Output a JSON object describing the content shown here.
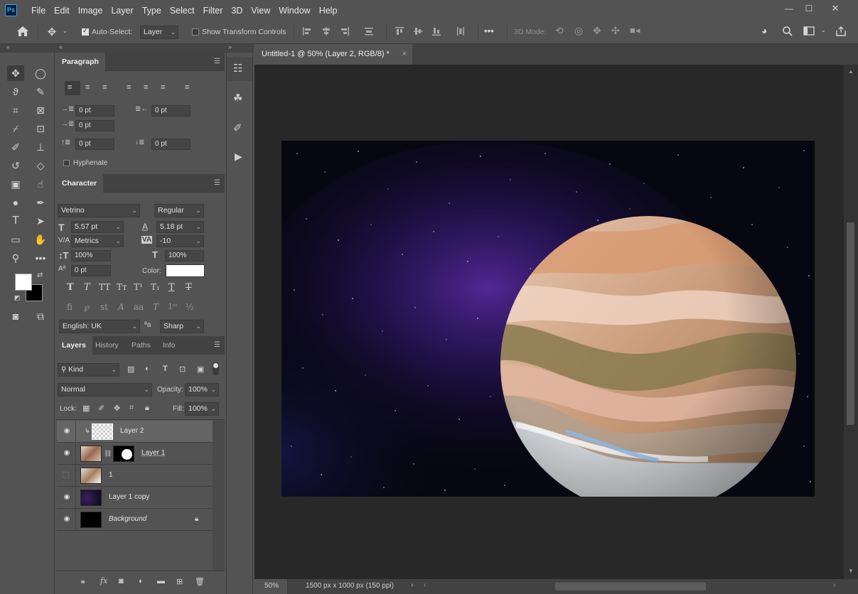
{
  "app": {
    "logo": "Ps",
    "menus": [
      "File",
      "Edit",
      "Image",
      "Layer",
      "Type",
      "Select",
      "Filter",
      "3D",
      "View",
      "Window",
      "Help"
    ],
    "window_controls": [
      "—",
      "☐",
      "✕"
    ]
  },
  "options": {
    "auto_select_label": "Auto-Select:",
    "auto_select_target": "Layer",
    "transform_label": "Show Transform Controls",
    "mode_label": "3D Mode:",
    "more": "•••"
  },
  "paragraph": {
    "tab": "Paragraph",
    "indent_left": "0 pt",
    "indent_right": "0 pt",
    "indent_first": "0 pt",
    "space_before": "0 pt",
    "space_after": "0 pt",
    "hyphenate": "Hyphenate"
  },
  "character": {
    "tab": "Character",
    "font_family": "Vetrino",
    "font_style": "Regular",
    "size": "5.57 pt",
    "leading": "5.18 pt",
    "kerning": "Metrics",
    "tracking": "-10",
    "vscale": "100%",
    "hscale": "100%",
    "baseline": "0 pt",
    "color_label": "Color:",
    "color": "#ffffff",
    "language": "English: UK",
    "aa_label": "ªa",
    "antialias": "Sharp"
  },
  "layers_panel": {
    "tabs": [
      "Layers",
      "History",
      "Paths",
      "Info"
    ],
    "filter": "Kind",
    "blend": "Normal",
    "opacity_label": "Opacity:",
    "opacity": "100%",
    "lock_label": "Lock:",
    "fill_label": "Fill:",
    "fill": "100%",
    "layers": [
      {
        "name": "Layer 2",
        "visible": true,
        "selected": true
      },
      {
        "name": "Layer 1",
        "visible": true,
        "selected": false
      },
      {
        "name": "1",
        "visible": false,
        "selected": false
      },
      {
        "name": "Layer 1 copy",
        "visible": true,
        "selected": false
      },
      {
        "name": "Background",
        "visible": true,
        "selected": false
      }
    ]
  },
  "document": {
    "tab": "Untitled-1 @ 50% (Layer 2, RGB/8) *",
    "zoom": "50%",
    "info": "1500 px x 1000 px (150 ppi)"
  },
  "colors": {
    "foreground": "#ffffff",
    "background": "#000000",
    "panel": "#535353",
    "canvas_bg": "#282828"
  }
}
